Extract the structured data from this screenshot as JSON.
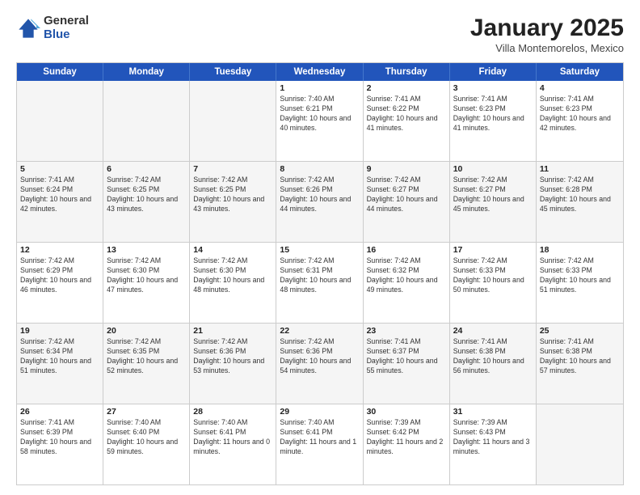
{
  "header": {
    "logo_general": "General",
    "logo_blue": "Blue",
    "title": "January 2025",
    "location": "Villa Montemorelos, Mexico"
  },
  "days_of_week": [
    "Sunday",
    "Monday",
    "Tuesday",
    "Wednesday",
    "Thursday",
    "Friday",
    "Saturday"
  ],
  "weeks": [
    [
      {
        "day": "",
        "info": ""
      },
      {
        "day": "",
        "info": ""
      },
      {
        "day": "",
        "info": ""
      },
      {
        "day": "1",
        "info": "Sunrise: 7:40 AM\nSunset: 6:21 PM\nDaylight: 10 hours\nand 40 minutes."
      },
      {
        "day": "2",
        "info": "Sunrise: 7:41 AM\nSunset: 6:22 PM\nDaylight: 10 hours\nand 41 minutes."
      },
      {
        "day": "3",
        "info": "Sunrise: 7:41 AM\nSunset: 6:23 PM\nDaylight: 10 hours\nand 41 minutes."
      },
      {
        "day": "4",
        "info": "Sunrise: 7:41 AM\nSunset: 6:23 PM\nDaylight: 10 hours\nand 42 minutes."
      }
    ],
    [
      {
        "day": "5",
        "info": "Sunrise: 7:41 AM\nSunset: 6:24 PM\nDaylight: 10 hours\nand 42 minutes."
      },
      {
        "day": "6",
        "info": "Sunrise: 7:42 AM\nSunset: 6:25 PM\nDaylight: 10 hours\nand 43 minutes."
      },
      {
        "day": "7",
        "info": "Sunrise: 7:42 AM\nSunset: 6:25 PM\nDaylight: 10 hours\nand 43 minutes."
      },
      {
        "day": "8",
        "info": "Sunrise: 7:42 AM\nSunset: 6:26 PM\nDaylight: 10 hours\nand 44 minutes."
      },
      {
        "day": "9",
        "info": "Sunrise: 7:42 AM\nSunset: 6:27 PM\nDaylight: 10 hours\nand 44 minutes."
      },
      {
        "day": "10",
        "info": "Sunrise: 7:42 AM\nSunset: 6:27 PM\nDaylight: 10 hours\nand 45 minutes."
      },
      {
        "day": "11",
        "info": "Sunrise: 7:42 AM\nSunset: 6:28 PM\nDaylight: 10 hours\nand 45 minutes."
      }
    ],
    [
      {
        "day": "12",
        "info": "Sunrise: 7:42 AM\nSunset: 6:29 PM\nDaylight: 10 hours\nand 46 minutes."
      },
      {
        "day": "13",
        "info": "Sunrise: 7:42 AM\nSunset: 6:30 PM\nDaylight: 10 hours\nand 47 minutes."
      },
      {
        "day": "14",
        "info": "Sunrise: 7:42 AM\nSunset: 6:30 PM\nDaylight: 10 hours\nand 48 minutes."
      },
      {
        "day": "15",
        "info": "Sunrise: 7:42 AM\nSunset: 6:31 PM\nDaylight: 10 hours\nand 48 minutes."
      },
      {
        "day": "16",
        "info": "Sunrise: 7:42 AM\nSunset: 6:32 PM\nDaylight: 10 hours\nand 49 minutes."
      },
      {
        "day": "17",
        "info": "Sunrise: 7:42 AM\nSunset: 6:33 PM\nDaylight: 10 hours\nand 50 minutes."
      },
      {
        "day": "18",
        "info": "Sunrise: 7:42 AM\nSunset: 6:33 PM\nDaylight: 10 hours\nand 51 minutes."
      }
    ],
    [
      {
        "day": "19",
        "info": "Sunrise: 7:42 AM\nSunset: 6:34 PM\nDaylight: 10 hours\nand 51 minutes."
      },
      {
        "day": "20",
        "info": "Sunrise: 7:42 AM\nSunset: 6:35 PM\nDaylight: 10 hours\nand 52 minutes."
      },
      {
        "day": "21",
        "info": "Sunrise: 7:42 AM\nSunset: 6:36 PM\nDaylight: 10 hours\nand 53 minutes."
      },
      {
        "day": "22",
        "info": "Sunrise: 7:42 AM\nSunset: 6:36 PM\nDaylight: 10 hours\nand 54 minutes."
      },
      {
        "day": "23",
        "info": "Sunrise: 7:41 AM\nSunset: 6:37 PM\nDaylight: 10 hours\nand 55 minutes."
      },
      {
        "day": "24",
        "info": "Sunrise: 7:41 AM\nSunset: 6:38 PM\nDaylight: 10 hours\nand 56 minutes."
      },
      {
        "day": "25",
        "info": "Sunrise: 7:41 AM\nSunset: 6:38 PM\nDaylight: 10 hours\nand 57 minutes."
      }
    ],
    [
      {
        "day": "26",
        "info": "Sunrise: 7:41 AM\nSunset: 6:39 PM\nDaylight: 10 hours\nand 58 minutes."
      },
      {
        "day": "27",
        "info": "Sunrise: 7:40 AM\nSunset: 6:40 PM\nDaylight: 10 hours\nand 59 minutes."
      },
      {
        "day": "28",
        "info": "Sunrise: 7:40 AM\nSunset: 6:41 PM\nDaylight: 11 hours\nand 0 minutes."
      },
      {
        "day": "29",
        "info": "Sunrise: 7:40 AM\nSunset: 6:41 PM\nDaylight: 11 hours\nand 1 minute."
      },
      {
        "day": "30",
        "info": "Sunrise: 7:39 AM\nSunset: 6:42 PM\nDaylight: 11 hours\nand 2 minutes."
      },
      {
        "day": "31",
        "info": "Sunrise: 7:39 AM\nSunset: 6:43 PM\nDaylight: 11 hours\nand 3 minutes."
      },
      {
        "day": "",
        "info": ""
      }
    ]
  ]
}
